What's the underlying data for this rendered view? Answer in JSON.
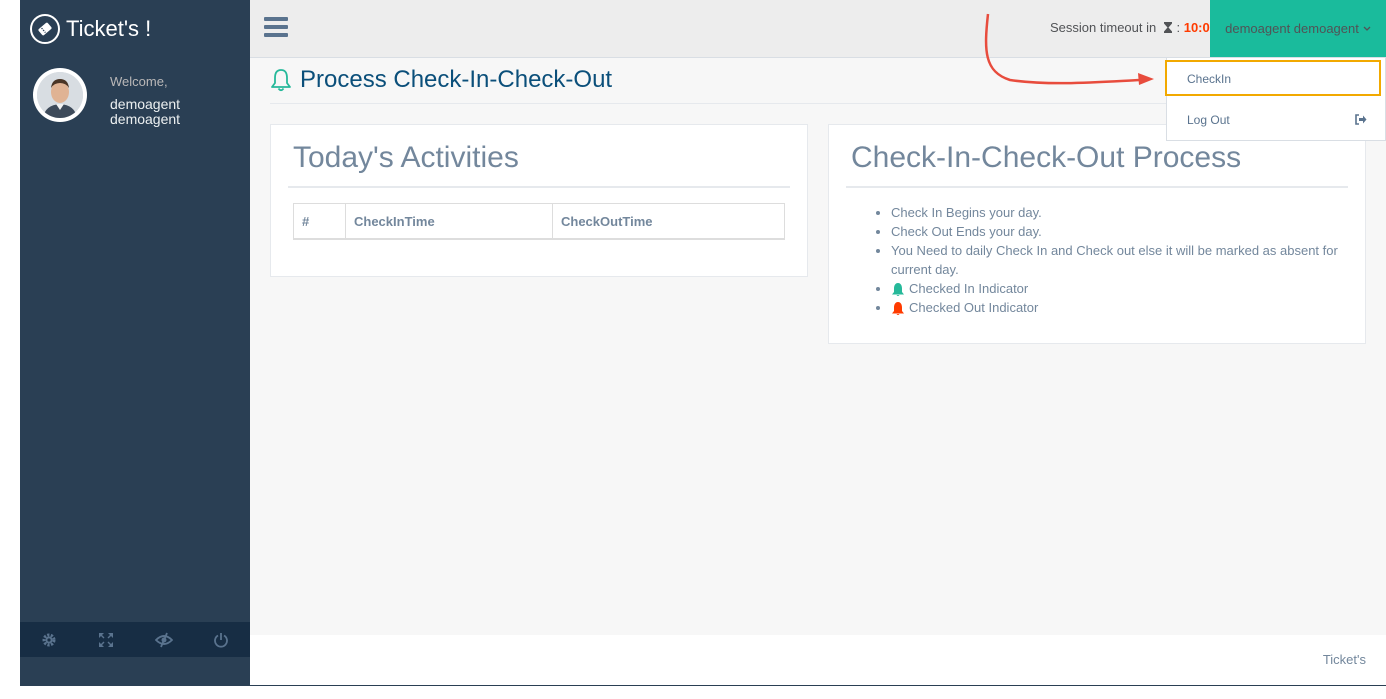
{
  "brand": {
    "title": "Ticket's !"
  },
  "profile": {
    "welcome": "Welcome,",
    "name": "demoagent demoagent"
  },
  "sidebar_footer": {
    "icons": [
      "gear-icon",
      "fullscreen-icon",
      "eye-slash-icon",
      "power-icon"
    ]
  },
  "topnav": {
    "session_label": "Session timeout in",
    "session_time": "10:0",
    "user_menu": "demoagent demoagent"
  },
  "dropdown": {
    "checkin": "CheckIn",
    "logout": "Log Out"
  },
  "page": {
    "title": "Process Check-In-Check-Out"
  },
  "activities": {
    "title": "Today's Activities",
    "columns": [
      "#",
      "CheckInTime",
      "CheckOutTime"
    ]
  },
  "process": {
    "title": "Check-In-Check-Out Process",
    "items": [
      "Check In Begins your day.",
      "Check Out Ends your day.",
      "You Need to daily Check In and Check out else it will be marked as absent for current day.",
      "Checked In Indicator",
      "Checked Out Indicator"
    ]
  },
  "footer": {
    "text": "Ticket's"
  },
  "colors": {
    "sidebar": "#2a3f54",
    "accent": "#1abb9c",
    "highlight": "#f2a900",
    "arrow": "#e84c3d",
    "checked_in": "#26b99a",
    "checked_out": "#ff3b00"
  }
}
